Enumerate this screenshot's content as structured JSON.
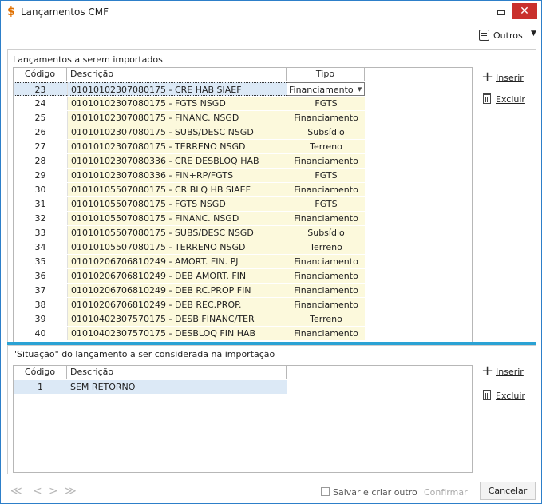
{
  "window": {
    "title": "Lançamentos CMF",
    "close_glyph": "✕"
  },
  "toolbar": {
    "outros_label": "Outros",
    "outros_icon": "list-icon"
  },
  "panel1": {
    "title": "Lançamentos a serem importados",
    "columns": [
      "Código",
      "Descrição",
      "Tipo"
    ],
    "rows": [
      {
        "code": "23",
        "desc": "01010102307080175 - CRE HAB SIAEF",
        "tipo": "Financiamento"
      },
      {
        "code": "24",
        "desc": "01010102307080175 - FGTS NSGD",
        "tipo": "FGTS"
      },
      {
        "code": "25",
        "desc": "01010102307080175 - FINANC. NSGD",
        "tipo": "Financiamento"
      },
      {
        "code": "26",
        "desc": "01010102307080175 - SUBS/DESC NSGD",
        "tipo": "Subsídio"
      },
      {
        "code": "27",
        "desc": "01010102307080175 - TERRENO NSGD",
        "tipo": "Terreno"
      },
      {
        "code": "28",
        "desc": "01010102307080336 - CRE DESBLOQ HAB",
        "tipo": "Financiamento"
      },
      {
        "code": "29",
        "desc": "01010102307080336 - FIN+RP/FGTS",
        "tipo": "FGTS"
      },
      {
        "code": "30",
        "desc": "01010105507080175 - CR BLQ HB SIAEF",
        "tipo": "Financiamento"
      },
      {
        "code": "31",
        "desc": "01010105507080175 - FGTS NSGD",
        "tipo": "FGTS"
      },
      {
        "code": "32",
        "desc": "01010105507080175 - FINANC. NSGD",
        "tipo": "Financiamento"
      },
      {
        "code": "33",
        "desc": "01010105507080175 - SUBS/DESC NSGD",
        "tipo": "Subsídio"
      },
      {
        "code": "34",
        "desc": "01010105507080175 - TERRENO NSGD",
        "tipo": "Terreno"
      },
      {
        "code": "35",
        "desc": "01010206706810249 - AMORT. FIN. PJ",
        "tipo": "Financiamento"
      },
      {
        "code": "36",
        "desc": "01010206706810249 - DEB AMORT. FIN",
        "tipo": "Financiamento"
      },
      {
        "code": "37",
        "desc": "01010206706810249 - DEB RC.PROP FIN",
        "tipo": "Financiamento"
      },
      {
        "code": "38",
        "desc": "01010206706810249 - DEB REC.PROP.",
        "tipo": "Financiamento"
      },
      {
        "code": "39",
        "desc": "01010402307570175 - DESB FINANC/TER",
        "tipo": "Terreno"
      },
      {
        "code": "40",
        "desc": "01010402307570175 - DESBLOQ FIN HAB",
        "tipo": "Financiamento"
      }
    ],
    "inserir_label": "Inserir",
    "excluir_label": "Excluir"
  },
  "panel2": {
    "title": "\"Situação\" do lançamento a ser considerada na importação",
    "columns": [
      "Código",
      "Descrição"
    ],
    "rows": [
      {
        "code": "1",
        "desc": "SEM RETORNO"
      }
    ],
    "inserir_label": "Inserir",
    "excluir_label": "Excluir"
  },
  "footer": {
    "nav": [
      "≪",
      "<",
      ">",
      "≫"
    ],
    "save_create_label": "Salvar e criar outro",
    "confirm_label": "Confirmar",
    "cancel_label": "Cancelar"
  }
}
